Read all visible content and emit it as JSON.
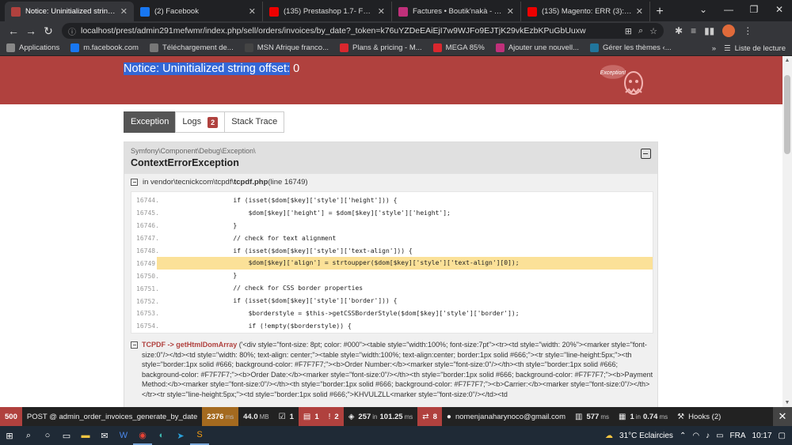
{
  "browser": {
    "tabs": [
      {
        "title": "Notice: Uninitialized string of",
        "favicon": "symfony-icon",
        "color": "#b0413e",
        "active": true
      },
      {
        "title": "(2) Facebook",
        "favicon": "facebook-icon",
        "color": "#1877f2",
        "active": false
      },
      {
        "title": "(135) Prestashop 1.7- Facture",
        "favicon": "youtube-icon",
        "color": "#e00",
        "active": false
      },
      {
        "title": "Factures • Boutik'nakà - Serv",
        "favicon": "prestashop-icon",
        "color": "#c0307a",
        "active": false
      },
      {
        "title": "(135) Magento: ERR (3): Notic",
        "favicon": "youtube-icon",
        "color": "#e00",
        "active": false
      }
    ],
    "new_tab": "+",
    "url": "localhost/prest/admin291mefwmr/index.php/sell/orders/invoices/by_date?_token=k76uYZDeEAiEjI7w9WJFo9EJTjK29vkEzbKPuGbUuxw",
    "bookmarks": [
      {
        "label": "Applications",
        "icon": "apps-grid-icon",
        "color": "#888"
      },
      {
        "label": "m.facebook.com",
        "icon": "facebook-icon",
        "color": "#1877f2"
      },
      {
        "label": "Téléchargement de...",
        "icon": "download-icon",
        "color": "#777"
      },
      {
        "label": "MSN Afrique franco...",
        "icon": "msn-icon",
        "color": "#444"
      },
      {
        "label": "Plans & pricing - M...",
        "icon": "mega-icon",
        "color": "#d9272e"
      },
      {
        "label": "MEGA 85%",
        "icon": "mega-icon",
        "color": "#d9272e"
      },
      {
        "label": "Ajouter une nouvell...",
        "icon": "prestashop-icon",
        "color": "#c0307a"
      },
      {
        "label": "Gérer les thèmes ‹...",
        "icon": "wordpress-icon",
        "color": "#21759b"
      }
    ],
    "reading_list": "Liste de lecture"
  },
  "page": {
    "notice_highlight": "Notice: Uninitialized string offset:",
    "notice_rest": " 0",
    "tabs": [
      {
        "label": "Exception",
        "active": true
      },
      {
        "label": "Logs",
        "badge": "2",
        "active": false
      },
      {
        "label": "Stack Trace",
        "active": false
      }
    ],
    "exception": {
      "namespace": "Symfony\\Component\\Debug\\Exception\\",
      "class": "ContextErrorException",
      "file_prefix": "in vendor\\tecnickcom\\tcpdf\\",
      "file_name": "tcpdf.php",
      "line_info": " (line 16749)",
      "code": [
        {
          "ln": "16744.",
          "src": "                    if (isset($dom[$key]['style']['height'])) {",
          "hl": false
        },
        {
          "ln": "16745.",
          "src": "                        $dom[$key]['height'] = $dom[$key]['style']['height'];",
          "hl": false
        },
        {
          "ln": "16746.",
          "src": "                    }",
          "hl": false
        },
        {
          "ln": "16747.",
          "src": "                    // check for text alignment",
          "hl": false
        },
        {
          "ln": "16748.",
          "src": "                    if (isset($dom[$key]['style']['text-align'])) {",
          "hl": false
        },
        {
          "ln": "16749.",
          "src": "                        $dom[$key]['align'] = strtoupper($dom[$key]['style']['text-align'][0]);",
          "hl": true
        },
        {
          "ln": "16750.",
          "src": "                    }",
          "hl": false
        },
        {
          "ln": "16751.",
          "src": "                    // check for CSS border properties",
          "hl": false
        },
        {
          "ln": "16752.",
          "src": "                    if (isset($dom[$key]['style']['border'])) {",
          "hl": false
        },
        {
          "ln": "16753.",
          "src": "                        $borderstyle = $this->getCSSBorderStyle($dom[$key]['style']['border']);",
          "hl": false
        },
        {
          "ln": "16754.",
          "src": "                        if (!empty($borderstyle)) {",
          "hl": false
        }
      ],
      "trace2_fn": "TCPDF -> getHtmlDomArray",
      "trace2_args": " ('<div style=\"font-size: 8pt; color: #000\"><table style=\"width:100%; font-size:7pt\"><tr><td style=\"width: 20%\"><marker style=\"font-size:0\"/></td><td style=\"width: 80%; text-align: center;\"><table style=\"width:100%; text-align:center; border:1px solid #666;\"><tr style=\"line-height:5px;\"><th style=\"border:1px solid #666; background-color: #F7F7F7;\"><b>Order Number:</b><marker style=\"font-size:0\"/></th><th style=\"border:1px solid #666; background-color: #F7F7F7;\"><b>Order Date:</b><marker style=\"font-size:0\"/></th><th style=\"border:1px solid #666; background-color: #F7F7F7;\"><b>Payment Method:</b><marker style=\"font-size:0\"/></th><th style=\"border:1px solid #666; background-color: #F7F7F7;\"><b>Carrier:</b><marker style=\"font-size:0\"/></th></tr><tr style=\"line-height:5px;\"><td style=\"border:1px solid #666;\">KHVULZLL<marker style=\"font-size:0\"/></td><td"
    }
  },
  "toolbar": {
    "status": "500",
    "route": "POST @ admin_order_invoices_generate_by_date",
    "time_value": "2376",
    "time_unit": "ms",
    "memory_value": "44.0",
    "memory_unit": "MB",
    "forms": "1",
    "form_errors": "1",
    "errors": "2",
    "cache": "257",
    "cache_in": "in",
    "cache_time": "101.25",
    "cache_unit": "ms",
    "translations": "8",
    "user": "nomenjanaharynoco@gmail.com",
    "twig_time": "577",
    "twig_unit": "ms",
    "db_queries": "1",
    "db_in": "in",
    "db_time": "0.74",
    "db_unit": "ms",
    "hooks": "Hooks (2)"
  },
  "taskbar": {
    "weather": "31°C  Eclaircies",
    "lang": "FRA",
    "time": "10:17"
  }
}
